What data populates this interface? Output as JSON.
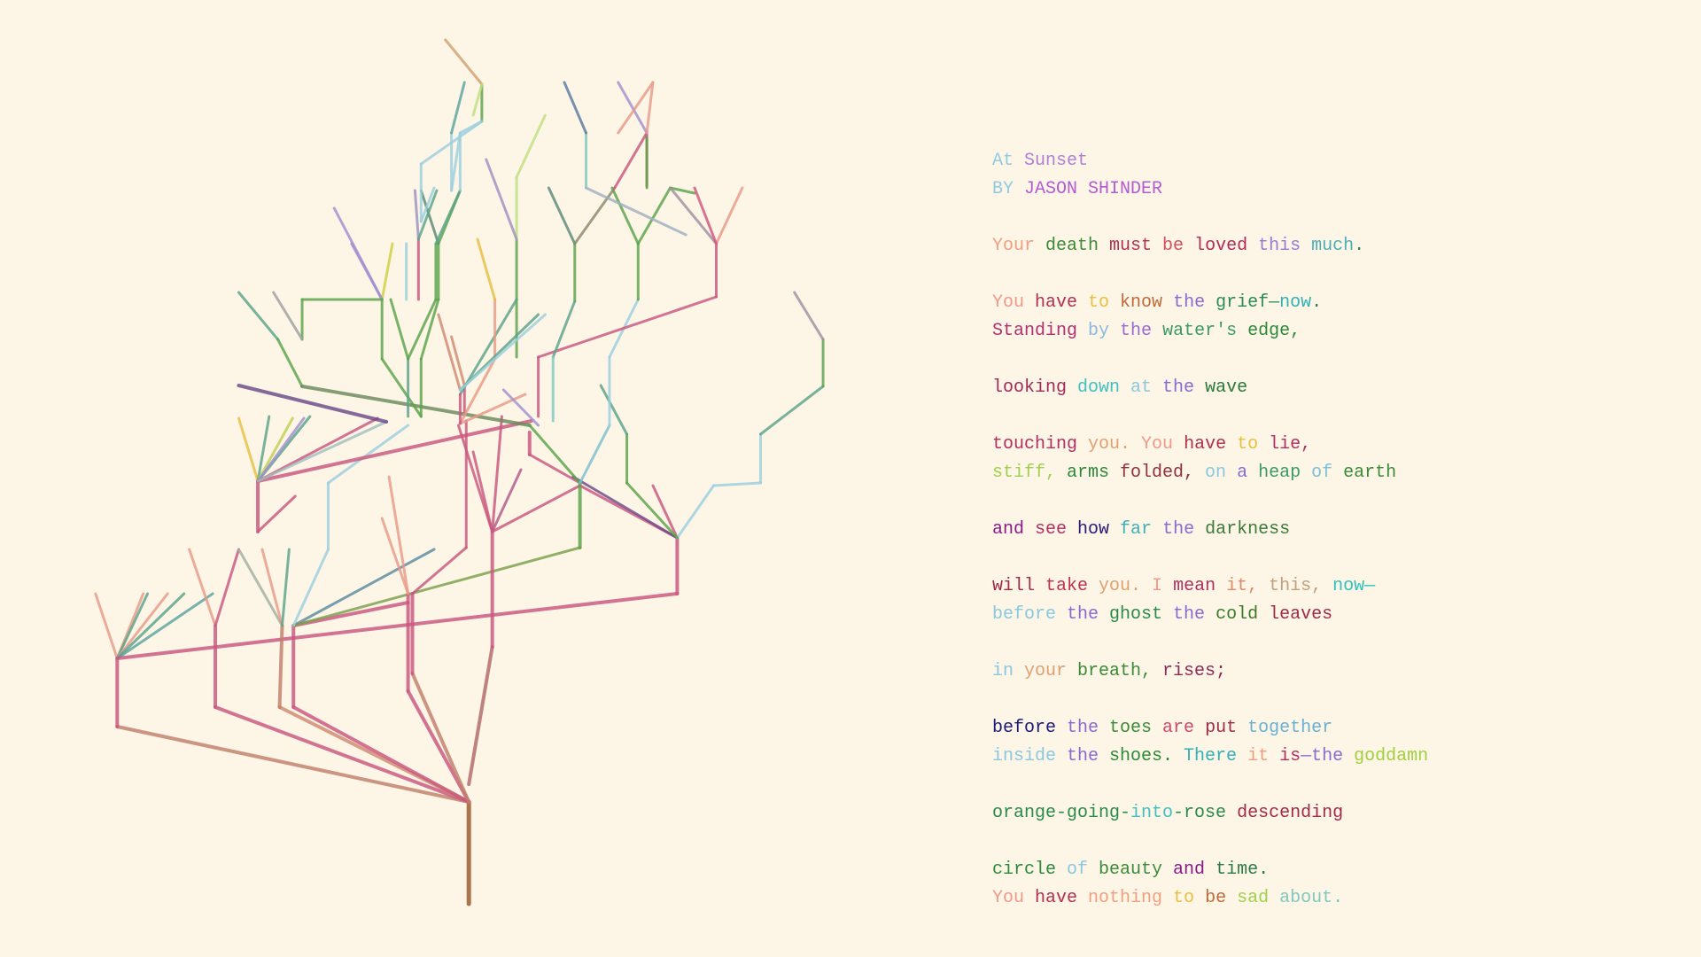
{
  "poem": {
    "lines": [
      [
        {
          "t": "At ",
          "c": "#8fcbe0"
        },
        {
          "t": "Sunset",
          "c": "#b07fd4"
        }
      ],
      [
        {
          "t": "BY ",
          "c": "#8fcbe0"
        },
        {
          "t": "JASON SHINDER",
          "c": "#b35bd1"
        }
      ],
      [],
      [
        {
          "t": "Your ",
          "c": "#f0a080"
        },
        {
          "t": "death ",
          "c": "#3a8a3a"
        },
        {
          "t": "must ",
          "c": "#b03050"
        },
        {
          "t": "be ",
          "c": "#d05060"
        },
        {
          "t": "loved ",
          "c": "#b02a5a"
        },
        {
          "t": "this ",
          "c": "#9a7ad0"
        },
        {
          "t": "much",
          "c": "#4ab0b8"
        },
        {
          "t": ".",
          "c": "#3a7a5a"
        }
      ],
      [],
      [
        {
          "t": "You ",
          "c": "#f09a8a"
        },
        {
          "t": "have ",
          "c": "#b03050"
        },
        {
          "t": "to ",
          "c": "#e8c040"
        },
        {
          "t": "know ",
          "c": "#c06a3a"
        },
        {
          "t": "the ",
          "c": "#8a6ad0"
        },
        {
          "t": "grief",
          "c": "#2a8a5a"
        },
        {
          "t": "—",
          "c": "#3a8a6a"
        },
        {
          "t": "now",
          "c": "#30b0b8"
        },
        {
          "t": ".",
          "c": "#3a7a5a"
        }
      ],
      [
        {
          "t": "Standing ",
          "c": "#b03070"
        },
        {
          "t": "by ",
          "c": "#8ab8e0"
        },
        {
          "t": "the ",
          "c": "#9a6ad0"
        },
        {
          "t": "water's ",
          "c": "#3a9a6a"
        },
        {
          "t": "edge,",
          "c": "#2a8a3a"
        }
      ],
      [],
      [
        {
          "t": "looking ",
          "c": "#a02a5a"
        },
        {
          "t": "down ",
          "c": "#40c0c0"
        },
        {
          "t": "at ",
          "c": "#8ac8e0"
        },
        {
          "t": "the ",
          "c": "#8a6ad0"
        },
        {
          "t": "wave",
          "c": "#2a7a3a"
        }
      ],
      [],
      [
        {
          "t": "touching ",
          "c": "#b03060"
        },
        {
          "t": "you. ",
          "c": "#e0a070"
        },
        {
          "t": "You ",
          "c": "#f09a8a"
        },
        {
          "t": "have ",
          "c": "#b03050"
        },
        {
          "t": "to ",
          "c": "#e8c040"
        },
        {
          "t": "lie,",
          "c": "#b03060"
        }
      ],
      [
        {
          "t": "stiff, ",
          "c": "#a0d050"
        },
        {
          "t": "arms ",
          "c": "#2a8a3a"
        },
        {
          "t": "folded, ",
          "c": "#903040"
        },
        {
          "t": "on ",
          "c": "#8ac8e0"
        },
        {
          "t": "a ",
          "c": "#8a6ad0"
        },
        {
          "t": "heap ",
          "c": "#3a9a6a"
        },
        {
          "t": "of ",
          "c": "#7ac0d8"
        },
        {
          "t": "earth",
          "c": "#3a8a3a"
        }
      ],
      [],
      [
        {
          "t": "and ",
          "c": "#8a1a8a"
        },
        {
          "t": "see ",
          "c": "#b03060"
        },
        {
          "t": "how ",
          "c": "#2a1a7a"
        },
        {
          "t": "far ",
          "c": "#40b0b8"
        },
        {
          "t": "the ",
          "c": "#8a6ad0"
        },
        {
          "t": "darkness",
          "c": "#3a7a3a"
        }
      ],
      [],
      [
        {
          "t": "will ",
          "c": "#a02a4a"
        },
        {
          "t": "take ",
          "c": "#c03050"
        },
        {
          "t": "you. ",
          "c": "#e0a070"
        },
        {
          "t": "I ",
          "c": "#f09a8a"
        },
        {
          "t": "mean ",
          "c": "#b03060"
        },
        {
          "t": "it, ",
          "c": "#e08a6a"
        },
        {
          "t": "this, ",
          "c": "#c0a080"
        },
        {
          "t": "now—",
          "c": "#30c0c0"
        }
      ],
      [
        {
          "t": "before ",
          "c": "#8ac8e0"
        },
        {
          "t": "the ",
          "c": "#8a6ad0"
        },
        {
          "t": "ghost ",
          "c": "#2a8a4a"
        },
        {
          "t": "the ",
          "c": "#8a6ad0"
        },
        {
          "t": "cold ",
          "c": "#3a7a2a"
        },
        {
          "t": "leaves",
          "c": "#a02a4a"
        }
      ],
      [],
      [
        {
          "t": "in ",
          "c": "#8ac8e0"
        },
        {
          "t": "your ",
          "c": "#e0a070"
        },
        {
          "t": "breath, ",
          "c": "#3a8a3a"
        },
        {
          "t": "rises;",
          "c": "#8a2a5a"
        }
      ],
      [],
      [
        {
          "t": "before ",
          "c": "#1a1a7a"
        },
        {
          "t": "the ",
          "c": "#8a6ad0"
        },
        {
          "t": "toes ",
          "c": "#3a8a3a"
        },
        {
          "t": "are ",
          "c": "#d04a6a"
        },
        {
          "t": "put ",
          "c": "#a02a4a"
        },
        {
          "t": "together",
          "c": "#6ab0d0"
        }
      ],
      [
        {
          "t": "inside ",
          "c": "#8ac8e0"
        },
        {
          "t": "the ",
          "c": "#8a6ad0"
        },
        {
          "t": "shoes. ",
          "c": "#2a8a3a"
        },
        {
          "t": "There ",
          "c": "#30b0b8"
        },
        {
          "t": "it ",
          "c": "#f0a080"
        },
        {
          "t": "is",
          "c": "#b03060"
        },
        {
          "t": "—the ",
          "c": "#8a6ad0"
        },
        {
          "t": "goddamn",
          "c": "#a0d040"
        }
      ],
      [],
      [
        {
          "t": "orange-going-",
          "c": "#2a8a4a"
        },
        {
          "t": "into",
          "c": "#40c0c0"
        },
        {
          "t": "-rose ",
          "c": "#2a8a4a"
        },
        {
          "t": "descending",
          "c": "#a02a4a"
        }
      ],
      [],
      [
        {
          "t": "circle ",
          "c": "#2a8a3a"
        },
        {
          "t": "of ",
          "c": "#8ac8e0"
        },
        {
          "t": "beauty ",
          "c": "#3a8a3a"
        },
        {
          "t": "and ",
          "c": "#8a1a8a"
        },
        {
          "t": "time.",
          "c": "#2a7a4a"
        }
      ],
      [
        {
          "t": "You ",
          "c": "#f09a8a"
        },
        {
          "t": "have ",
          "c": "#b03050"
        },
        {
          "t": "nothing ",
          "c": "#f0a080"
        },
        {
          "t": "to ",
          "c": "#e8c040"
        },
        {
          "t": "be ",
          "c": "#c06a3a"
        },
        {
          "t": "sad ",
          "c": "#a0d050"
        },
        {
          "t": "about.",
          "c": "#80c8c0"
        }
      ]
    ]
  },
  "tree": {
    "trunk_color": "#9a5a2a",
    "palette": [
      "#c8577e",
      "#5aa34a",
      "#e89a88",
      "#9ccfdf",
      "#6a4a8a",
      "#f0a080",
      "#80c8c0",
      "#b05a8a",
      "#a0d050",
      "#d0b040"
    ]
  }
}
